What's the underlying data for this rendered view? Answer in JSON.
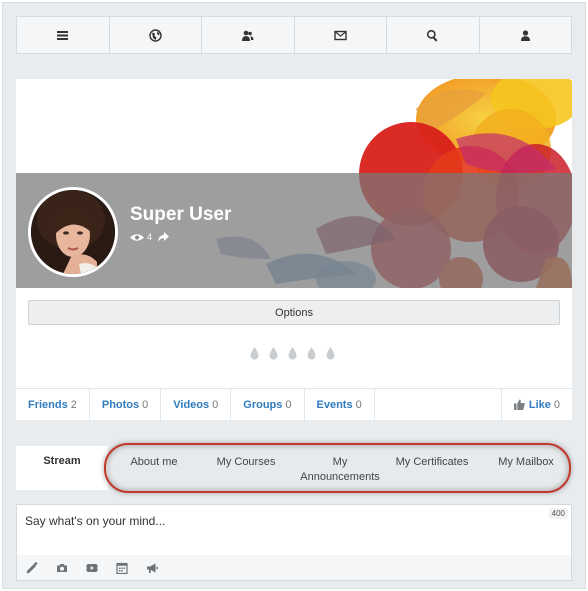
{
  "nav": {
    "icons": [
      "menu-icon",
      "globe-icon",
      "users-icon",
      "mail-icon",
      "search-icon",
      "user-icon"
    ]
  },
  "profile": {
    "name": "Super User",
    "views": "4",
    "options_label": "Options"
  },
  "stats": [
    {
      "label": "Friends",
      "count": "2"
    },
    {
      "label": "Photos",
      "count": "0"
    },
    {
      "label": "Videos",
      "count": "0"
    },
    {
      "label": "Groups",
      "count": "0"
    },
    {
      "label": "Events",
      "count": "0"
    }
  ],
  "like": {
    "label": "Like",
    "count": "0"
  },
  "tabs": {
    "active": "Stream",
    "items": [
      "About me",
      "My Courses",
      "My Announcements",
      "My Certificates",
      "My Mailbox"
    ]
  },
  "composer": {
    "placeholder": "Say what's on your mind...",
    "char_limit": "400"
  },
  "colors": {
    "link": "#2f7bbd",
    "highlight_ring": "#c0392b"
  }
}
